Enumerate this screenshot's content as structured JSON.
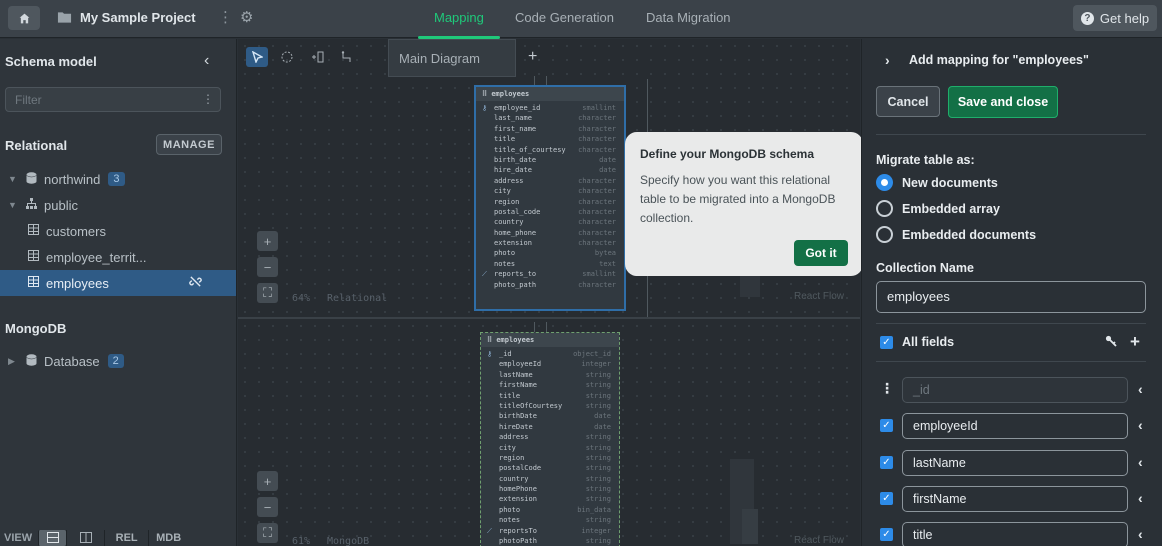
{
  "topbar": {
    "project_name": "My Sample Project",
    "tabs": [
      {
        "label": "Mapping",
        "active": true
      },
      {
        "label": "Code Generation",
        "active": false
      },
      {
        "label": "Data Migration",
        "active": false
      }
    ],
    "help_label": "Get help"
  },
  "sidebar": {
    "title": "Schema model",
    "filter_placeholder": "Filter",
    "relational_label": "Relational",
    "manage_label": "MANAGE",
    "tree": [
      {
        "label": "northwind",
        "badge": "3",
        "icon": "database-icon"
      },
      {
        "label": "public",
        "icon": "schema-tree-icon"
      },
      {
        "label": "customers",
        "icon": "table-icon"
      },
      {
        "label": "employee_territ...",
        "icon": "table-icon"
      },
      {
        "label": "employees",
        "icon": "table-icon",
        "selected": true
      }
    ],
    "mongodb_label": "MongoDB",
    "mongo_tree": [
      {
        "label": "Database",
        "badge": "2",
        "icon": "database-icon"
      }
    ],
    "viewbar": {
      "label": "VIEW",
      "rel": "REL",
      "mdb": "MDB"
    }
  },
  "canvas": {
    "diagram_tab": "Main Diagram",
    "relational_pane": {
      "zoom": "64%",
      "label": "Relational",
      "react_flow": "React Flow"
    },
    "mongo_pane": {
      "zoom": "61%",
      "label": "MongoDB",
      "react_flow": "React Flow"
    },
    "relational_table": {
      "name": "employees",
      "columns": [
        {
          "name": "employee_id",
          "type": "smallint",
          "key": true
        },
        {
          "name": "last_name",
          "type": "character"
        },
        {
          "name": "first_name",
          "type": "character"
        },
        {
          "name": "title",
          "type": "character"
        },
        {
          "name": "title_of_courtesy",
          "type": "character"
        },
        {
          "name": "birth_date",
          "type": "date"
        },
        {
          "name": "hire_date",
          "type": "date"
        },
        {
          "name": "address",
          "type": "character"
        },
        {
          "name": "city",
          "type": "character"
        },
        {
          "name": "region",
          "type": "character"
        },
        {
          "name": "postal_code",
          "type": "character"
        },
        {
          "name": "country",
          "type": "character"
        },
        {
          "name": "home_phone",
          "type": "character"
        },
        {
          "name": "extension",
          "type": "character"
        },
        {
          "name": "photo",
          "type": "bytea"
        },
        {
          "name": "notes",
          "type": "text"
        },
        {
          "name": "reports_to",
          "type": "smallint",
          "fk": true
        },
        {
          "name": "photo_path",
          "type": "character"
        }
      ]
    },
    "mongo_collection": {
      "name": "employees",
      "fields": [
        {
          "name": "_id",
          "type": "object_id",
          "key": true
        },
        {
          "name": "employeeId",
          "type": "integer"
        },
        {
          "name": "lastName",
          "type": "string"
        },
        {
          "name": "firstName",
          "type": "string"
        },
        {
          "name": "title",
          "type": "string"
        },
        {
          "name": "titleOfCourtesy",
          "type": "string"
        },
        {
          "name": "birthDate",
          "type": "date"
        },
        {
          "name": "hireDate",
          "type": "date"
        },
        {
          "name": "address",
          "type": "string"
        },
        {
          "name": "city",
          "type": "string"
        },
        {
          "name": "region",
          "type": "string"
        },
        {
          "name": "postalCode",
          "type": "string"
        },
        {
          "name": "country",
          "type": "string"
        },
        {
          "name": "homePhone",
          "type": "string"
        },
        {
          "name": "extension",
          "type": "string"
        },
        {
          "name": "photo",
          "type": "bin_data"
        },
        {
          "name": "notes",
          "type": "string"
        },
        {
          "name": "reportsTo",
          "type": "integer",
          "fk": true
        },
        {
          "name": "photoPath",
          "type": "string"
        }
      ]
    }
  },
  "tooltip": {
    "title": "Define your MongoDB schema",
    "body": "Specify how you want this relational table to be migrated into a MongoDB collection.",
    "button": "Got it"
  },
  "panel": {
    "title": "Add mapping for \"employees\"",
    "cancel_label": "Cancel",
    "save_label": "Save and close",
    "migrate_label": "Migrate table as:",
    "options": [
      {
        "label": "New documents",
        "selected": true
      },
      {
        "label": "Embedded array",
        "selected": false
      },
      {
        "label": "Embedded documents",
        "selected": false
      }
    ],
    "collection_name_label": "Collection Name",
    "collection_name_value": "employees",
    "all_fields_label": "All fields",
    "fields": [
      {
        "name": "_id",
        "checked": false,
        "disabled": true
      },
      {
        "name": "employeeId",
        "checked": true
      },
      {
        "name": "lastName",
        "checked": true
      },
      {
        "name": "firstName",
        "checked": true
      },
      {
        "name": "title",
        "checked": true
      }
    ]
  },
  "colors": {
    "accent_green": "#1fc97a",
    "button_green": "#137046",
    "select_blue": "#2f5b86",
    "radio_blue": "#2d8be8"
  }
}
